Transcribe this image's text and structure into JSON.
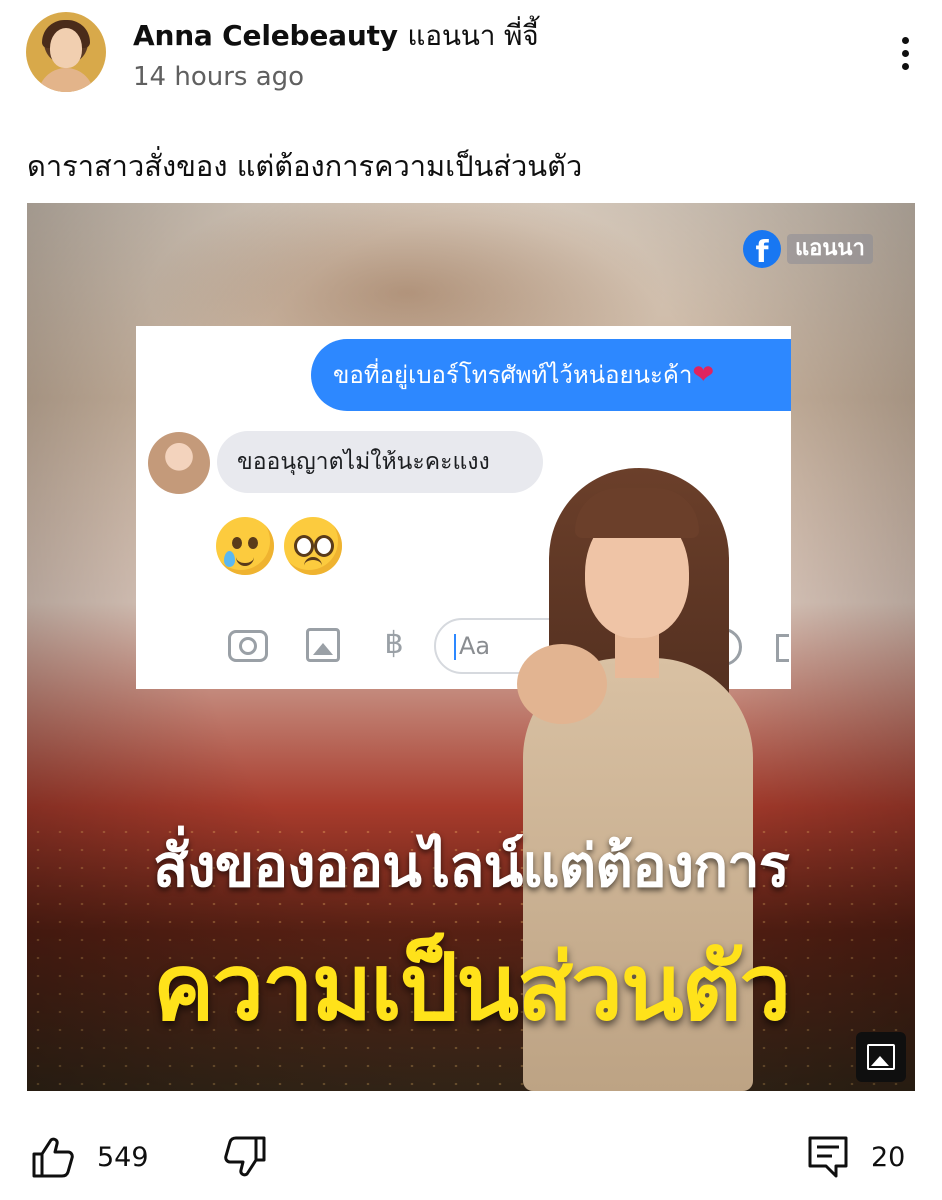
{
  "post": {
    "author_name": "Anna Celebeauty",
    "author_thai": "แอนนา พี่จี้",
    "timestamp": "14 hours ago",
    "caption": "ดาราสาวสั่งของ แต่ต้องการความเป็นส่วนตัว"
  },
  "image": {
    "fb_icon": "facebook-icon",
    "fb_label": "f",
    "source_tag": "แอนนา",
    "chat": {
      "outgoing_message": "ขอที่อยู่เบอร์โทรศัพท์ไว้หน่อยนะค้า",
      "outgoing_emoji": "❤",
      "incoming_message": "ขออนุญาตไม่ให้นะคะแงง",
      "emojis": [
        "crying-face-emoji",
        "pleading-face-emoji"
      ],
      "input_placeholder": "Aa",
      "baht_symbol": "฿"
    },
    "headline_line1": "สั่งของออนไลน์แต่ต้องการ",
    "headline_line2": "ความเป็นส่วนตัว"
  },
  "actions": {
    "like_count": "549",
    "comment_count": "20"
  },
  "colors": {
    "messenger_blue": "#2d88ff",
    "facebook_blue": "#1877f2",
    "headline_yellow": "#ffe21a"
  }
}
